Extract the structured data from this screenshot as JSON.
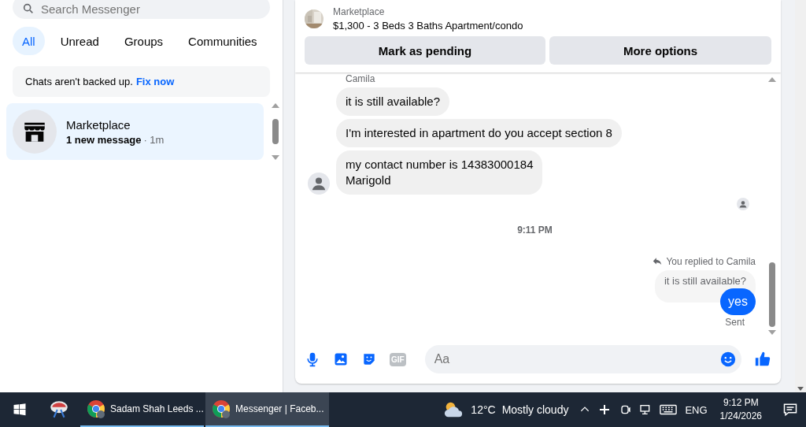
{
  "sidebar": {
    "search": {
      "placeholder": "Search Messenger"
    },
    "filters": [
      {
        "label": "All",
        "selected": true
      },
      {
        "label": "Unread",
        "selected": false
      },
      {
        "label": "Groups",
        "selected": false
      },
      {
        "label": "Communities",
        "selected": false
      }
    ],
    "backup_notice": {
      "text": "Chats aren't backed up.",
      "link": "Fix now"
    },
    "conversations": [
      {
        "name": "Marketplace",
        "preview": "1 new message",
        "time": "· 1m",
        "unread": true,
        "selected": true
      }
    ]
  },
  "chat": {
    "listing": {
      "label": "Marketplace",
      "title": "$1,300 - 3 Beds 3 Baths Apartment/condo"
    },
    "actions": [
      "Mark as pending",
      "More options"
    ],
    "messages": [
      {
        "kind": "sender",
        "text": "Camila"
      },
      {
        "kind": "incoming",
        "text": "it is still available?"
      },
      {
        "kind": "incoming",
        "text": "I'm interested in apartment do you accept section 8"
      },
      {
        "kind": "incoming",
        "text": "my contact number is 14383000184\nMarigold",
        "avatar": true
      },
      {
        "kind": "seen"
      },
      {
        "kind": "time",
        "text": "9:11 PM"
      },
      {
        "kind": "reply_note",
        "text": "You replied to Camila"
      },
      {
        "kind": "quote",
        "text": "it is still available?"
      },
      {
        "kind": "outgoing",
        "text": "yes"
      },
      {
        "kind": "status",
        "text": "Sent"
      }
    ],
    "composer": {
      "gif": "GIF",
      "placeholder": "Aa"
    }
  },
  "taskbar": {
    "tasks": [
      {
        "label": "Sadam Shah Leeds ...",
        "selected": false
      },
      {
        "label": "Messenger | Faceb...",
        "selected": true
      }
    ],
    "weather": {
      "temp": "12°C",
      "condition": "Mostly cloudy"
    },
    "language": "ENG",
    "time": "9:12 PM",
    "date": "1/24/2026"
  }
}
